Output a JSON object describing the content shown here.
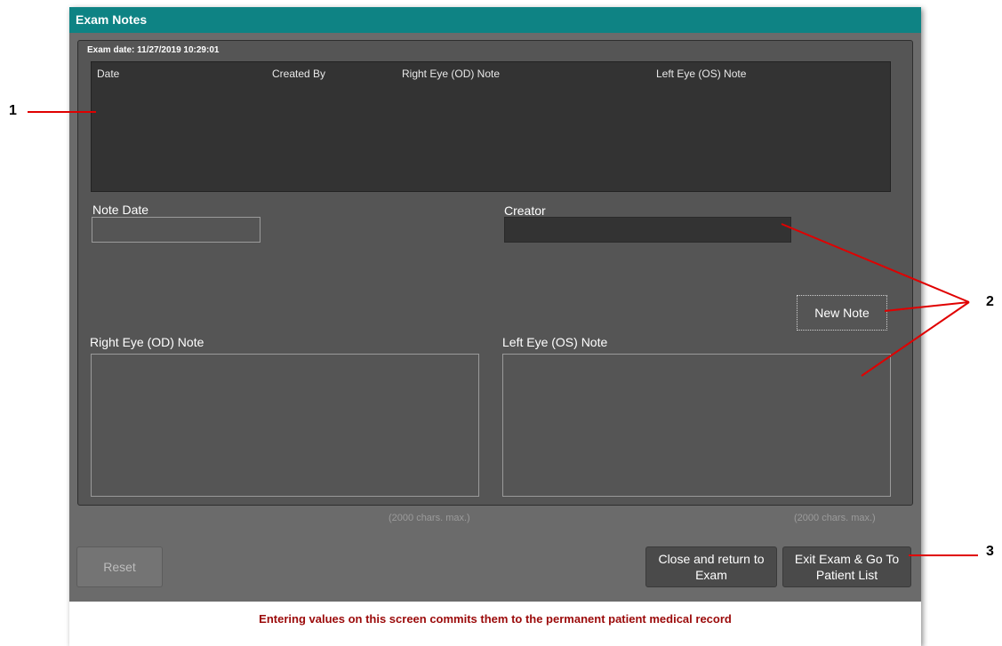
{
  "window": {
    "title": "Exam Notes"
  },
  "exam_date": "Exam date: 11/27/2019 10:29:01",
  "table": {
    "columns": [
      "Date",
      "Created By",
      "Right Eye (OD) Note",
      "Left Eye (OS) Note"
    ],
    "rows": []
  },
  "form": {
    "note_date_label": "Note Date",
    "note_date_value": "",
    "creator_label": "Creator",
    "creator_value": "",
    "new_note_button": "New Note",
    "right_eye_label": "Right Eye (OD) Note",
    "left_eye_label": "Left Eye (OS) Note",
    "right_eye_value": "",
    "left_eye_value": "",
    "right_eye_limit": "(2000 chars. max.)",
    "left_eye_limit": "(2000 chars. max.)"
  },
  "buttons": {
    "reset": "Reset",
    "close_return": "Close and return to Exam",
    "exit_exam": "Exit Exam & Go To Patient List"
  },
  "footer_warning": "Entering values on this screen commits them to the permanent patient medical record",
  "callouts": [
    "1",
    "2",
    "3"
  ],
  "colors": {
    "title_bar": "#0e8384",
    "callout_line": "#e00000",
    "warning_text": "#9b0a0a"
  }
}
